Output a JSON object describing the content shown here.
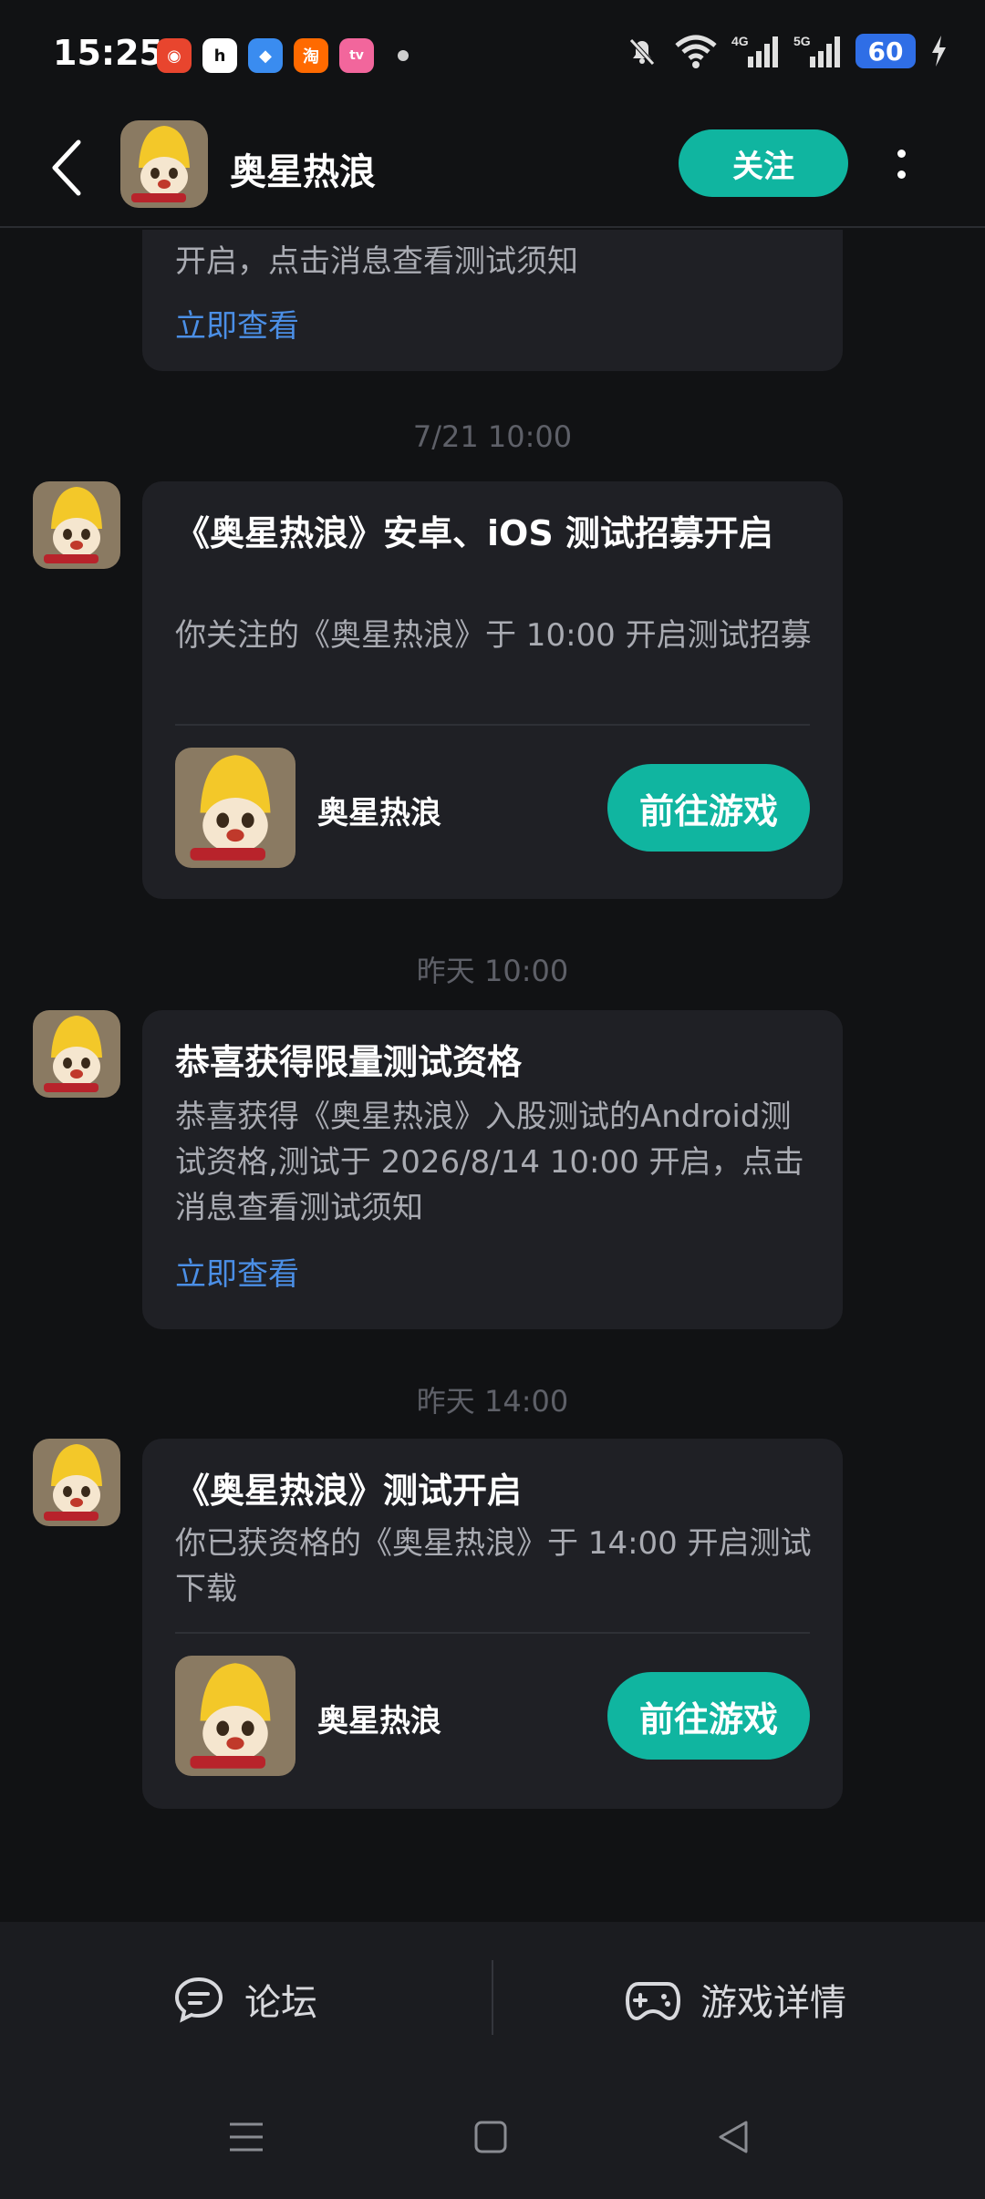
{
  "status_bar": {
    "time": "15:25",
    "apps": [
      {
        "icon": "app-icon-red",
        "color": "#e8452e",
        "glyph": "◉"
      },
      {
        "icon": "app-icon-h",
        "color": "#ffffff",
        "glyph": "h"
      },
      {
        "icon": "app-icon-blue",
        "color": "#3a8cf0",
        "glyph": "◆"
      },
      {
        "icon": "taobao-icon",
        "color": "#ff6a00",
        "glyph": "淘"
      },
      {
        "icon": "bilibili-icon",
        "color": "#f2669c",
        "glyph": "tv"
      }
    ],
    "network_4g": "4G",
    "network_5g": "5G",
    "battery": "60"
  },
  "header": {
    "title": "奥星热浪",
    "follow_label": "关注"
  },
  "messages": [
    {
      "partial_text": "开启，点击消息查看测试须知",
      "link": "立即查看"
    },
    {
      "timestamp": "7/21  10:00",
      "title": "《奥星热浪》安卓、iOS 测试招募开启",
      "text": "你关注的《奥星热浪》于 10:00 开启测试招募",
      "game_name": "奥星热浪",
      "button": "前往游戏"
    },
    {
      "timestamp": "昨天  10:00",
      "title": "恭喜获得限量测试资格",
      "text": "恭喜获得《奥星热浪》入股测试的Android测试资格,测试于 2026/8/14 10:00 开启，点击消息查看测试须知",
      "link": "立即查看"
    },
    {
      "timestamp": "昨天  14:00",
      "title": "《奥星热浪》测试开启",
      "text": "你已获资格的《奥星热浪》于 14:00 开启测试下载",
      "game_name": "奥星热浪",
      "button": "前往游戏"
    }
  ],
  "bottom_bar": {
    "forum_label": "论坛",
    "details_label": "游戏详情"
  },
  "colors": {
    "accent": "#10b5a0",
    "link": "#4b8fe6",
    "card_bg": "#1f2025"
  }
}
